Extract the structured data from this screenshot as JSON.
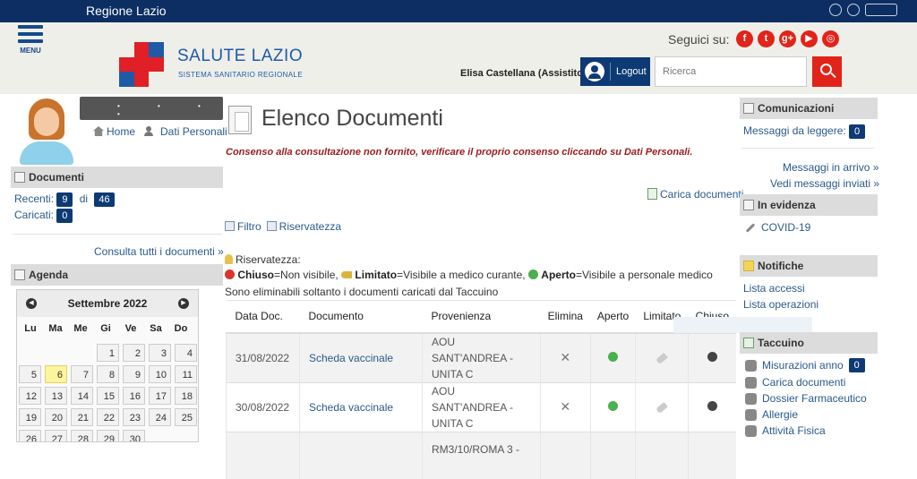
{
  "topbar": {
    "title": "Regione Lazio"
  },
  "header": {
    "menu_label": "MENU",
    "brand_title": "SALUTE LAZIO",
    "brand_subtitle": "SISTEMA SANITARIO REGIONALE",
    "seguici": "Seguici su:",
    "social": [
      "f",
      "t",
      "g+",
      "▶",
      "◎"
    ],
    "user_name": "Elisa Castellana (Assistito)",
    "logout_label": "Logout",
    "search_placeholder": "Ricerca"
  },
  "left": {
    "home_label": "Home",
    "dati_personali_label": "Dati Personali",
    "documenti": {
      "title": "Documenti",
      "recenti_label": "Recenti:",
      "recenti_count": "9",
      "di_label": "di",
      "totale_count": "46",
      "caricati_label": "Caricati:",
      "caricati_count": "0",
      "consulta_link": "Consulta tutti i documenti »"
    },
    "agenda": {
      "title": "Agenda",
      "month": "Settembre 2022",
      "weekdays": [
        "Lu",
        "Ma",
        "Me",
        "Gi",
        "Ve",
        "Sa",
        "Do"
      ],
      "days": [
        "",
        "",
        "",
        "1",
        "2",
        "3",
        "4",
        "5",
        "6",
        "7",
        "8",
        "9",
        "10",
        "11",
        "12",
        "13",
        "14",
        "15",
        "16",
        "17",
        "18",
        "19",
        "20",
        "21",
        "22",
        "23",
        "24",
        "25",
        "26",
        "27",
        "28",
        "29",
        "30",
        "",
        ""
      ],
      "today": "6"
    }
  },
  "main": {
    "title": "Elenco Documenti",
    "consenso_msg": "Consenso alla consultazione non fornito, verificare il proprio consenso cliccando su Dati Personali.",
    "carica_documenti": "Carica documenti",
    "filtro_label": "Filtro",
    "riservatezza_label": "Riservatezza",
    "legend": {
      "title": "Riservatezza:",
      "chiuso_b": "Chiuso",
      "chiuso_t": "=Non visibile,",
      "limitato_b": "Limitato",
      "limitato_t": "=Visibile a medico curante,",
      "aperto_b": "Aperto",
      "aperto_t": "=Visibile a personale medico"
    },
    "eliminabili": "Sono eliminabili soltanto i documenti caricati dal Taccuino",
    "table": {
      "headers": [
        "Data Doc.",
        "Documento",
        "Provenienza",
        "Elimina",
        "Aperto",
        "Limitato",
        "Chiuso"
      ],
      "rows": [
        {
          "date": "31/08/2022",
          "documento": "Scheda vaccinale",
          "provenienza": "AOU SANT'ANDREA - UNITA C"
        },
        {
          "date": "30/08/2022",
          "documento": "Scheda vaccinale",
          "provenienza": "AOU SANT'ANDREA - UNITA C"
        },
        {
          "date": "",
          "documento": "",
          "provenienza": "RM3/10/ROMA 3 -"
        }
      ]
    }
  },
  "right": {
    "comunicazioni": {
      "title": "Comunicazioni",
      "messaggi_label": "Messaggi da leggere:",
      "messaggi_count": "0",
      "in_arrivo": "Messaggi in arrivo »",
      "inviati": "Vedi messaggi inviati »"
    },
    "in_evidenza": {
      "title": "In evidenza",
      "covid": "COVID-19"
    },
    "notifiche": {
      "title": "Notifiche",
      "accessi": "Lista accessi",
      "operazioni": "Lista operazioni"
    },
    "taccuino": {
      "title": "Taccuino",
      "misurazioni": "Misurazioni anno",
      "misurazioni_count": "0",
      "carica": "Carica documenti",
      "dossier": "Dossier Farmaceutico",
      "allergie": "Allergie",
      "attivita": "Attività Fisica"
    }
  }
}
